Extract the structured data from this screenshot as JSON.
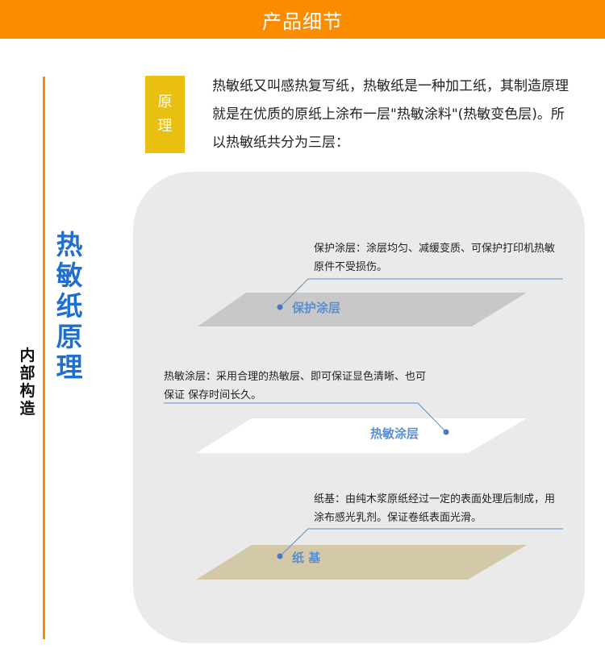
{
  "header": {
    "title": "产品细节"
  },
  "side": {
    "label": "内部构造"
  },
  "section": {
    "title": "热敏纸原理"
  },
  "principle": {
    "badge": "原理",
    "text": "热敏纸又叫感热复写纸，热敏纸是一种加工纸，其制造原理就是在优质的原纸上涂布一层\"热敏涂料\"(热敏变色层)。所以热敏纸共分为三层："
  },
  "layers": [
    {
      "name": "保护涂层",
      "desc": "保护涂层：涂层均匀、减缓变质、可保护打印机热敏原件不受损伤。",
      "color": "#c8c8c8"
    },
    {
      "name": "热敏涂层",
      "desc": "热敏涂层：采用合理的热敏层、即可保证显色清晰、也可保证 保存时间长久。",
      "color": "#ffffff"
    },
    {
      "name": "纸 基",
      "desc": "纸基：由纯木浆原纸经过一定的表面处理后制成，用涂布感光乳剂。保证卷纸表面光滑。",
      "color": "#d3c8a8"
    }
  ],
  "colors": {
    "accent": "#fb8c00",
    "title_blue": "#1f6fd3",
    "badge": "#e9bf10",
    "line_blue": "#5a8fcf"
  }
}
